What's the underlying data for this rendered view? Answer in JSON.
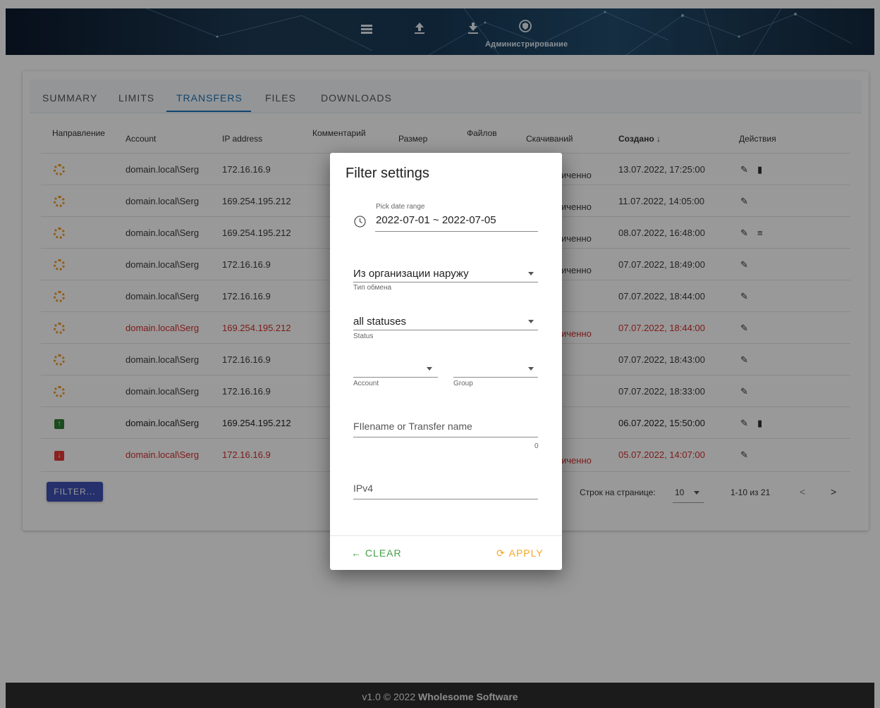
{
  "header": {
    "admin_label": "Администрирование"
  },
  "tabs": [
    "SUMMARY",
    "LIMITS",
    "TRANSFERS",
    "FILES",
    "DOWNLOADS"
  ],
  "table": {
    "headers": {
      "direction": "Направление",
      "account": "Account",
      "ip": "IP address",
      "comment": "Комментарий",
      "size": "Размер",
      "files": "Файлов",
      "downloads": "Скачиваний",
      "created": "Создано ↓",
      "actions": "Действия"
    },
    "rows": [
      {
        "account": "domain.local\\Serg",
        "ip": "172.16.16.9",
        "status": "иченно",
        "created": "13.07.2022, 17:25:00"
      },
      {
        "account": "domain.local\\Serg",
        "ip": "169.254.195.212",
        "status": "иченно",
        "created": "11.07.2022, 14:05:00"
      },
      {
        "account": "domain.local\\Serg",
        "ip": "169.254.195.212",
        "status": "иченно",
        "created": "08.07.2022, 16:48:00"
      },
      {
        "account": "domain.local\\Serg",
        "ip": "172.16.16.9",
        "status": "иченно",
        "created": "07.07.2022, 18:49:00"
      },
      {
        "account": "domain.local\\Serg",
        "ip": "172.16.16.9",
        "status": "",
        "created": "07.07.2022, 18:44:00"
      },
      {
        "account": "domain.local\\Serg",
        "ip": "169.254.195.212",
        "status": "иченно",
        "created": "07.07.2022, 18:44:00"
      },
      {
        "account": "domain.local\\Serg",
        "ip": "172.16.16.9",
        "status": "",
        "created": "07.07.2022, 18:43:00"
      },
      {
        "account": "domain.local\\Serg",
        "ip": "172.16.16.9",
        "status": "",
        "created": "07.07.2022, 18:33:00"
      },
      {
        "account": "domain.local\\Serg",
        "ip": "169.254.195.212",
        "status": "",
        "created": "06.07.2022, 15:50:00"
      },
      {
        "account": "domain.local\\Serg",
        "ip": "172.16.16.9",
        "status": "иченно",
        "created": "05.07.2022, 14:07:00"
      }
    ]
  },
  "filter_button": "FILTER...",
  "pager": {
    "rows_label": "Строк на странице:",
    "rows_value": "10",
    "range": "1-10 из 21",
    "prev": "<",
    "next": ">"
  },
  "footer": {
    "prefix": "v1.0 © 2022",
    "company": "Wholesome Software"
  },
  "dialog": {
    "title": "Filter settings",
    "date_label": "Pick date range",
    "date_value": "2022-07-01 ~ 2022-07-05",
    "exchange_value": "Из организации наружу",
    "exchange_label": "Тип обмена",
    "status_value": "all statuses",
    "status_label": "Status",
    "account_label": "Account",
    "group_label": "Group",
    "filename_placeholder": "FIlename or Transfer name",
    "filename_counter": "0",
    "ipv4_placeholder": "IPv4",
    "clear_label": "CLEAR",
    "apply_label": "APPLY"
  },
  "colors": {
    "accent": "#1e73b8",
    "red_text": "#d32f2f",
    "upload_green": "#2e7d32",
    "download_red": "#e53935",
    "pending_orange": "#f29b2b",
    "dialog_green": "#43a047",
    "dialog_orange": "#f5a623"
  },
  "icons": {
    "nav": [
      "list-icon",
      "upload-icon",
      "download-icon",
      "admin-shield-icon"
    ],
    "row_actions": [
      "edit-icon",
      "delete-icon",
      "list-icon"
    ]
  }
}
